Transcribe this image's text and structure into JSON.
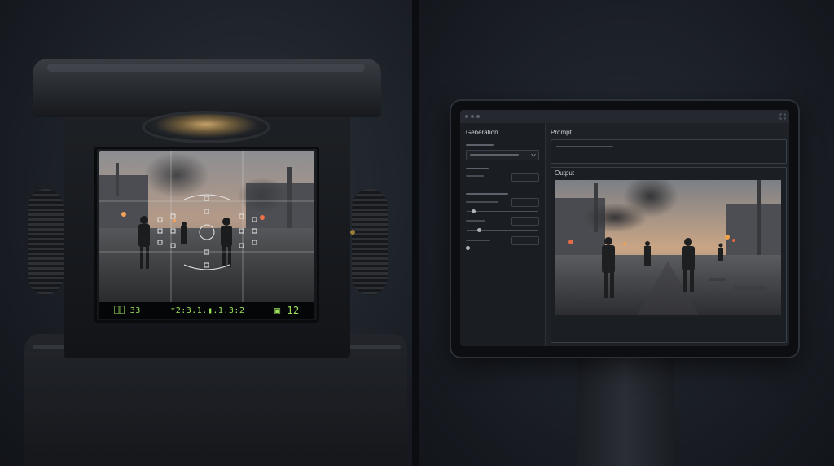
{
  "viewfinder": {
    "readout_left": "⎕⎕ 33",
    "readout_mid": "*2:3.1.▮.1.3:2",
    "readout_right": "▣ 12"
  },
  "app": {
    "sidebar_title": "Generation",
    "prompt_title": "Prompt",
    "output_title": "Output"
  },
  "icons": [
    "expand-icon",
    "chevron-down-icon",
    "focus-point-icon"
  ]
}
